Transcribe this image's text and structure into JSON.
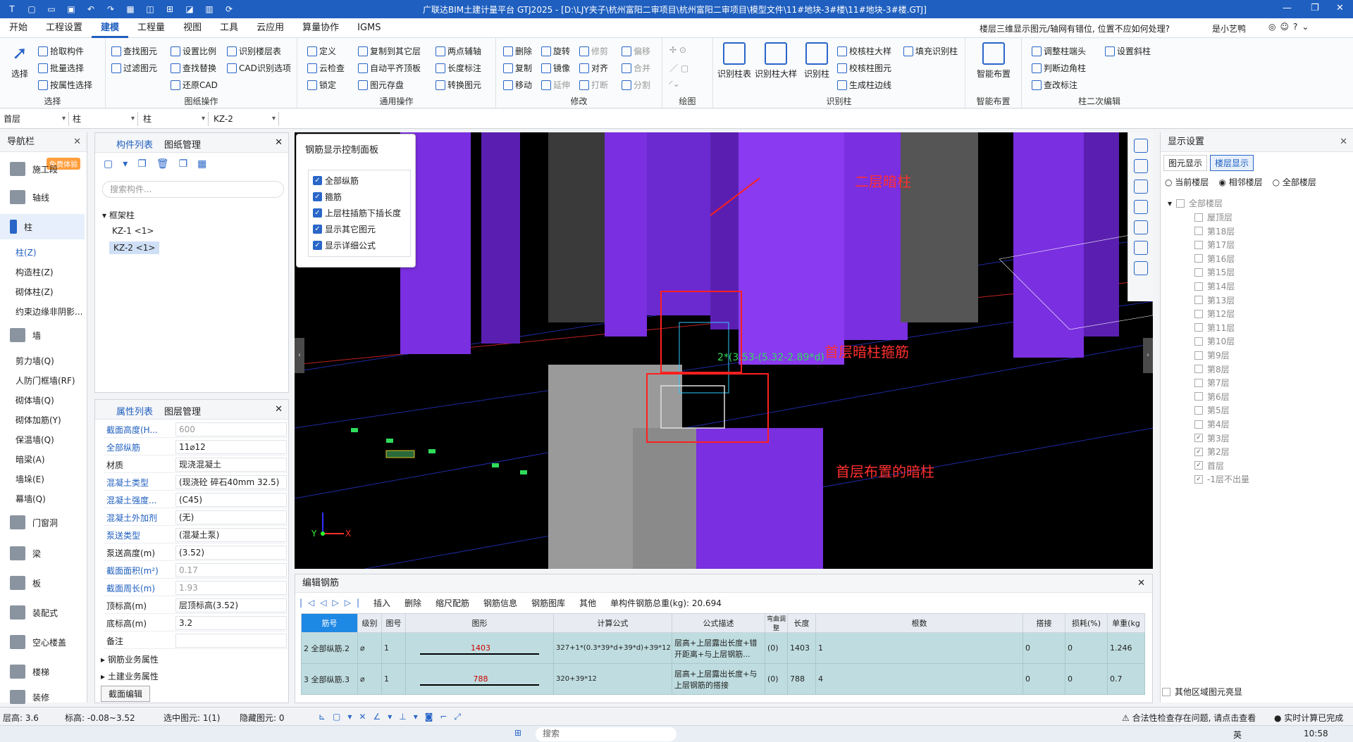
{
  "titlebar": {
    "title": "广联达BIM土建计量平台 GTJ2025 - [D:\\LJY夹子\\杭州富阳二审项目\\杭州富阳二审项目\\模型文件\\11#地块-3#楼\\11#地块-3#楼.GTJ]"
  },
  "menu": [
    "开始",
    "工程设置",
    "建模",
    "工程量",
    "视图",
    "工具",
    "云应用",
    "算量协作",
    "IGMS"
  ],
  "question": {
    "text": "楼层三维显示图元/轴网有错位, 位置不应如何处理?",
    "user": "是小艺鸭"
  },
  "ribbon": {
    "select": {
      "label": "选择",
      "group": "选择",
      "items": [
        "拾取构件",
        "批量选择",
        "按属性选择"
      ]
    },
    "cad": {
      "group": "图纸操作",
      "items": [
        "查找图元",
        "过滤图元",
        "设置比例",
        "查找替换",
        "识别楼层表",
        "CAD识别选项",
        "还原CAD"
      ]
    },
    "general": {
      "group": "通用操作",
      "items": [
        "定义",
        "云检查",
        "锁定",
        "复制到其它层",
        "自动平齐顶板",
        "图元存盘",
        "两点辅轴",
        "长度标注",
        "转换图元"
      ]
    },
    "modify": {
      "group": "修改",
      "items": [
        "删除",
        "旋转",
        "修剪",
        "偏移",
        "复制",
        "镜像",
        "对齐",
        "合并",
        "移动",
        "延伸",
        "打断",
        "分割"
      ]
    },
    "draw": {
      "group": "绘图"
    },
    "identify": {
      "group": "识别柱",
      "big": [
        "识别柱表",
        "识别柱大样",
        "识别柱"
      ],
      "items": [
        "校核柱大样",
        "填充识别柱",
        "校核柱图元",
        "生成柱边线"
      ]
    },
    "smart": {
      "group": "智能布置",
      "label": "智能布置"
    },
    "edit2": {
      "group": "柱二次编辑",
      "items": [
        "调整柱端头",
        "设置斜柱",
        "判断边角柱",
        "查改标注"
      ]
    }
  },
  "selectors": [
    "首层",
    "柱",
    "柱",
    "KZ-2"
  ],
  "nav": {
    "title": "导航栏",
    "badge": "免费体验",
    "groups": [
      "施工段",
      "轴线",
      "柱",
      "墙",
      "门窗洞",
      "梁",
      "板",
      "装配式",
      "空心楼盖",
      "楼梯",
      "装修"
    ],
    "subs": [
      "柱(Z)",
      "构造柱(Z)",
      "砌体柱(Z)",
      "约束边缘非阴影...",
      "剪力墙(Q)",
      "人防门框墙(RF)",
      "砌体墙(Q)",
      "砌体加筋(Y)",
      "保温墙(Q)",
      "暗梁(A)",
      "墙垛(E)",
      "幕墙(Q)"
    ]
  },
  "components": {
    "tab1": "构件列表",
    "tab2": "图纸管理",
    "search": "搜索构件...",
    "group": "框架柱",
    "items": [
      "KZ-1 <1>",
      "KZ-2 <1>"
    ]
  },
  "properties": {
    "tab1": "属性列表",
    "tab2": "图层管理",
    "rows": [
      {
        "k": "截面高度(H...",
        "v": "600"
      },
      {
        "k": "全部纵筋",
        "v": "11⌀12"
      },
      {
        "k": "材质",
        "v": "现浇混凝土"
      },
      {
        "k": "混凝土类型",
        "v": "(现浇砼 碎石40mm 32.5)"
      },
      {
        "k": "混凝土强度...",
        "v": "(C45)"
      },
      {
        "k": "混凝土外加剂",
        "v": "(无)"
      },
      {
        "k": "泵送类型",
        "v": "(混凝土泵)"
      },
      {
        "k": "泵送高度(m)",
        "v": "(3.52)"
      },
      {
        "k": "截面面积(m²)",
        "v": "0.17"
      },
      {
        "k": "截面周长(m)",
        "v": "1.93"
      },
      {
        "k": "顶标高(m)",
        "v": "层顶标高(3.52)"
      },
      {
        "k": "底标高(m)",
        "v": "3.2"
      },
      {
        "k": "备注",
        "v": ""
      }
    ],
    "ext1": "钢筋业务属性",
    "ext2": "土建业务属性",
    "btn": "截面编辑"
  },
  "rebar_panel": {
    "title": "钢筋显示控制面板",
    "items": [
      "全部纵筋",
      "箍筋",
      "上层柱插筋下插长度",
      "显示其它图元",
      "显示详细公式"
    ]
  },
  "viewport": {
    "anno1": "二层暗柱",
    "anno2": "首层暗柱箍筋",
    "anno3": "首层布置的暗柱",
    "dim": "2*(3.53-(5.32-2.89*d)"
  },
  "display": {
    "title": "显示设置",
    "tab1": "图元显示",
    "tab2": "楼层显示",
    "radios": [
      "当前楼层",
      "相邻楼层",
      "全部楼层"
    ],
    "root": "全部楼层",
    "floors": [
      {
        "n": "屋顶层",
        "c": false
      },
      {
        "n": "第18层",
        "c": false
      },
      {
        "n": "第17层",
        "c": false
      },
      {
        "n": "第16层",
        "c": false
      },
      {
        "n": "第15层",
        "c": false
      },
      {
        "n": "第14层",
        "c": false
      },
      {
        "n": "第13层",
        "c": false
      },
      {
        "n": "第12层",
        "c": false
      },
      {
        "n": "第11层",
        "c": false
      },
      {
        "n": "第10层",
        "c": false
      },
      {
        "n": "第9层",
        "c": false
      },
      {
        "n": "第8层",
        "c": false
      },
      {
        "n": "第7层",
        "c": false
      },
      {
        "n": "第6层",
        "c": false
      },
      {
        "n": "第5层",
        "c": false
      },
      {
        "n": "第4层",
        "c": false
      },
      {
        "n": "第3层",
        "c": true
      },
      {
        "n": "第2层",
        "c": true
      },
      {
        "n": "首层",
        "c": true
      },
      {
        "n": "-1层不出量",
        "c": true
      }
    ],
    "other": "其他区域图元亮显"
  },
  "editor": {
    "title": "编辑钢筋",
    "toolbar": [
      "插入",
      "删除",
      "缩尺配筋",
      "钢筋信息",
      "钢筋图库",
      "其他"
    ],
    "total": "单构件钢筋总重(kg): 20.694",
    "headers": [
      "筋号",
      "级别",
      "图号",
      "图形",
      "计算公式",
      "公式描述",
      "弯曲调整",
      "长度",
      "根数",
      "搭接",
      "损耗(%)",
      "单重(kg"
    ],
    "rows": [
      {
        "no": "2",
        "name": "全部纵筋.2",
        "lvl": "⌀",
        "fig": "1",
        "shape": "1403",
        "formula": "327+1*(0.3*39*d+39*d)+39*12",
        "desc": "层高+上层露出长度+错开距离+与上层钢筋...",
        "bend": "(0)",
        "len": "1403",
        "cnt": "1",
        "lap": "0",
        "loss": "0",
        "w": "1.246"
      },
      {
        "no": "3",
        "name": "全部纵筋.3",
        "lvl": "⌀",
        "fig": "1",
        "shape": "788",
        "formula": "320+39*12",
        "desc": "层高+上层露出长度+与上层钢筋的搭接",
        "bend": "(0)",
        "len": "788",
        "cnt": "4",
        "lap": "0",
        "loss": "0",
        "w": "0.7"
      }
    ]
  },
  "status": {
    "floor_h": "层高: 3.6",
    "elev": "标高: -0.08~3.52",
    "sel": "选中图元: 1(1)",
    "hidden": "隐藏图元: 0",
    "warn": "合法性检查存在问题, 请点击查看",
    "calc": "实时计算已完成"
  },
  "taskbar": {
    "search": "搜索",
    "time": "10:58",
    "lang": "英"
  }
}
